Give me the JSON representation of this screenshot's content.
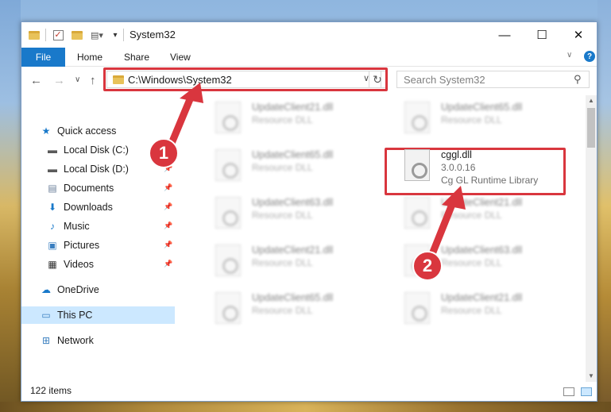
{
  "window": {
    "title": "System32",
    "minimize": "—",
    "maximize": "☐",
    "close": "✕"
  },
  "ribbon": {
    "file_tab": "File",
    "tabs": [
      "Home",
      "Share",
      "View"
    ],
    "expand": "∨",
    "help": "?"
  },
  "navigation": {
    "back": "←",
    "forward": "→",
    "recent": "∨",
    "up": "↑",
    "address_path": "C:\\Windows\\System32",
    "address_dropdown": "∨",
    "refresh": "↻",
    "search_placeholder": "Search System32",
    "search_icon": "⚲"
  },
  "sidebar": {
    "items": [
      {
        "label": "Quick access",
        "icon": "star-icon",
        "glyph": "★",
        "color": "#1979ca",
        "pinned": false,
        "top": true
      },
      {
        "label": "Local Disk (C:)",
        "icon": "drive-icon",
        "glyph": "▬",
        "color": "#5a5a5a",
        "pinned": true
      },
      {
        "label": "Local Disk (D:)",
        "icon": "drive-icon",
        "glyph": "▬",
        "color": "#5a5a5a",
        "pinned": true
      },
      {
        "label": "Documents",
        "icon": "documents-icon",
        "glyph": "▤",
        "color": "#6b7f9a",
        "pinned": true
      },
      {
        "label": "Downloads",
        "icon": "downloads-icon",
        "glyph": "⬇",
        "color": "#1979ca",
        "pinned": true
      },
      {
        "label": "Music",
        "icon": "music-icon",
        "glyph": "♪",
        "color": "#1979ca",
        "pinned": true
      },
      {
        "label": "Pictures",
        "icon": "pictures-icon",
        "glyph": "▣",
        "color": "#3a7fc0",
        "pinned": true
      },
      {
        "label": "Videos",
        "icon": "videos-icon",
        "glyph": "▦",
        "color": "#333333",
        "pinned": true
      },
      {
        "label": "OneDrive",
        "icon": "onedrive-icon",
        "glyph": "☁",
        "color": "#1979ca",
        "pinned": false,
        "top": true
      },
      {
        "label": "This PC",
        "icon": "this-pc-icon",
        "glyph": "▭",
        "color": "#3a7fc0",
        "pinned": false,
        "top": true,
        "selected": true
      },
      {
        "label": "Network",
        "icon": "network-icon",
        "glyph": "⊞",
        "color": "#3a7fc0",
        "pinned": false,
        "top": true
      }
    ]
  },
  "files": [
    {
      "name": "UpdateClient21.dll",
      "line1": "Resource DLL",
      "line2": "",
      "blurred": true
    },
    {
      "name": "UpdateClient65.dll",
      "line1": "Resource DLL",
      "line2": "",
      "blurred": true
    },
    {
      "name": "UpdateClient65.dll",
      "line1": "Resource DLL",
      "line2": "",
      "blurred": true
    },
    {
      "name": "cggl.dll",
      "line1": "3.0.0.16",
      "line2": "Cg GL Runtime Library",
      "blurred": false
    },
    {
      "name": "UpdateClient63.dll",
      "line1": "Resource DLL",
      "line2": "",
      "blurred": true
    },
    {
      "name": "UpdateClient21.dll",
      "line1": "Resource DLL",
      "line2": "",
      "blurred": true
    },
    {
      "name": "UpdateClient21.dll",
      "line1": "Resource DLL",
      "line2": "",
      "blurred": true
    },
    {
      "name": "UpdateClient63.dll",
      "line1": "Resource DLL",
      "line2": "",
      "blurred": true
    },
    {
      "name": "UpdateClient65.dll",
      "line1": "Resource DLL",
      "line2": "",
      "blurred": true
    },
    {
      "name": "UpdateClient21.dll",
      "line1": "Resource DLL",
      "line2": "",
      "blurred": true
    }
  ],
  "status": {
    "item_count": "122 items"
  },
  "annotations": {
    "step1": "1",
    "step2": "2",
    "color": "#d9363e"
  }
}
